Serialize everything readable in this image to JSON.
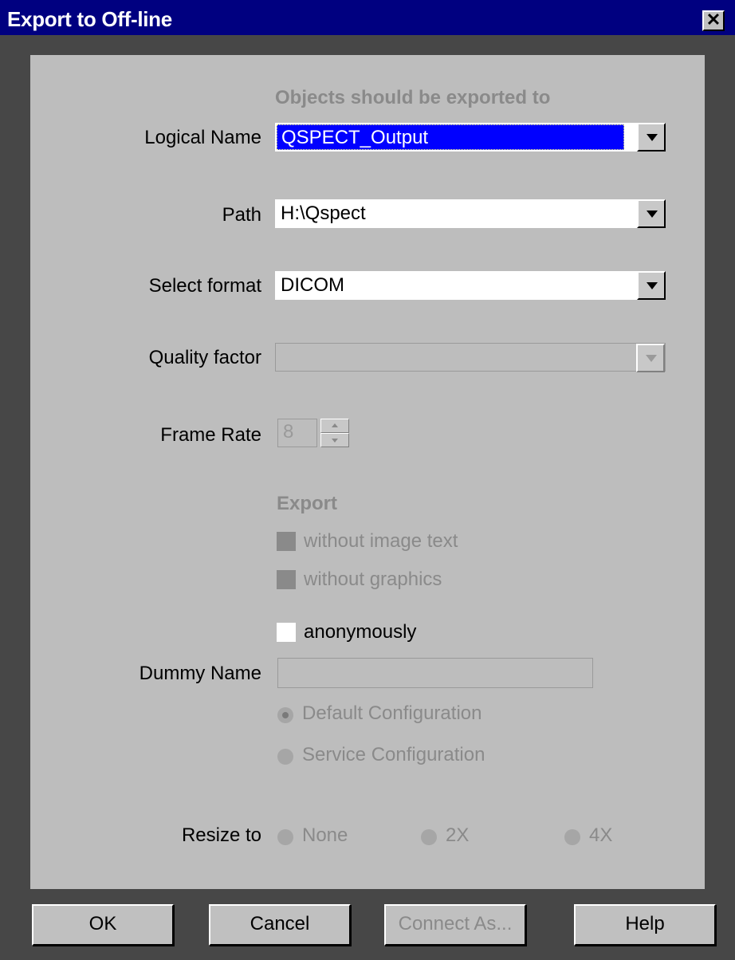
{
  "window": {
    "title": "Export to Off-line",
    "close_glyph": "✕"
  },
  "destination": {
    "heading": "Objects should be exported to",
    "logical_name": {
      "label": "Logical Name",
      "value": "QSPECT_Output",
      "selected": true
    },
    "path": {
      "label": "Path",
      "value": "H:\\Qspect"
    },
    "format": {
      "label": "Select format",
      "value": "DICOM"
    },
    "quality": {
      "label": "Quality factor",
      "value": "",
      "enabled": false
    },
    "frame_rate": {
      "label": "Frame Rate",
      "value": "8",
      "enabled": false
    }
  },
  "export_options": {
    "heading": "Export",
    "without_image_text": {
      "label": "without image text",
      "enabled": false
    },
    "without_graphics": {
      "label": "without graphics",
      "enabled": false
    },
    "anonymously": {
      "label": "anonymously",
      "checked": false,
      "enabled": true
    },
    "dummy_name": {
      "label": "Dummy Name",
      "value": "",
      "enabled": false
    },
    "config_radios": [
      {
        "label": "Default Configuration",
        "checked": true
      },
      {
        "label": "Service Configuration",
        "checked": false
      }
    ]
  },
  "resize": {
    "label": "Resize to",
    "options": [
      {
        "label": "None"
      },
      {
        "label": "2X"
      },
      {
        "label": "4X"
      }
    ]
  },
  "buttons": {
    "ok": "OK",
    "cancel": "Cancel",
    "connect_as": "Connect As...",
    "help": "Help"
  },
  "colors": {
    "titlebar": "#000080",
    "dialog_bg": "#bdbdbd",
    "frame": "#474747",
    "selection": "#0000ff",
    "disabled_text": "#8a8a8a"
  }
}
